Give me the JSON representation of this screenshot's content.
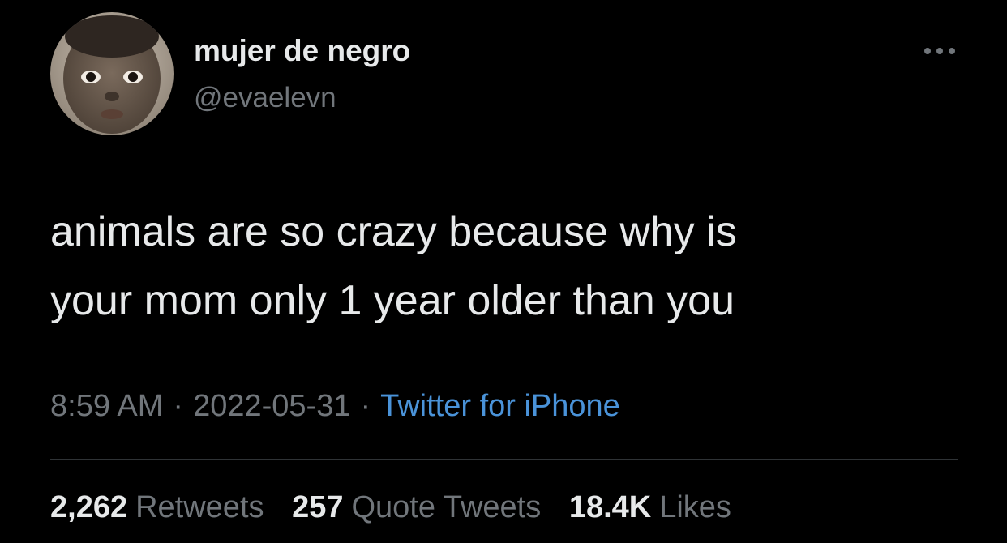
{
  "author": {
    "display_name": "mujer de negro",
    "handle": "@evaelevn"
  },
  "more_icon": "more-horizontal-icon",
  "tweet": {
    "lines": [
      "animals are so crazy because why is",
      "your mom only 1 year older than you"
    ]
  },
  "meta": {
    "time": "8:59 AM",
    "separator": "·",
    "date": "2022-05-31",
    "source": "Twitter for iPhone"
  },
  "stats": {
    "retweets_count": "2,262",
    "retweets_label": "Retweets",
    "quotes_count": "257",
    "quotes_label": "Quote Tweets",
    "likes_count": "18.4K",
    "likes_label": "Likes"
  },
  "colors": {
    "background": "#000000",
    "primary_text": "#e7e9ea",
    "secondary_text": "#71767b",
    "link": "#4a93d9",
    "divider": "#2f3336"
  }
}
